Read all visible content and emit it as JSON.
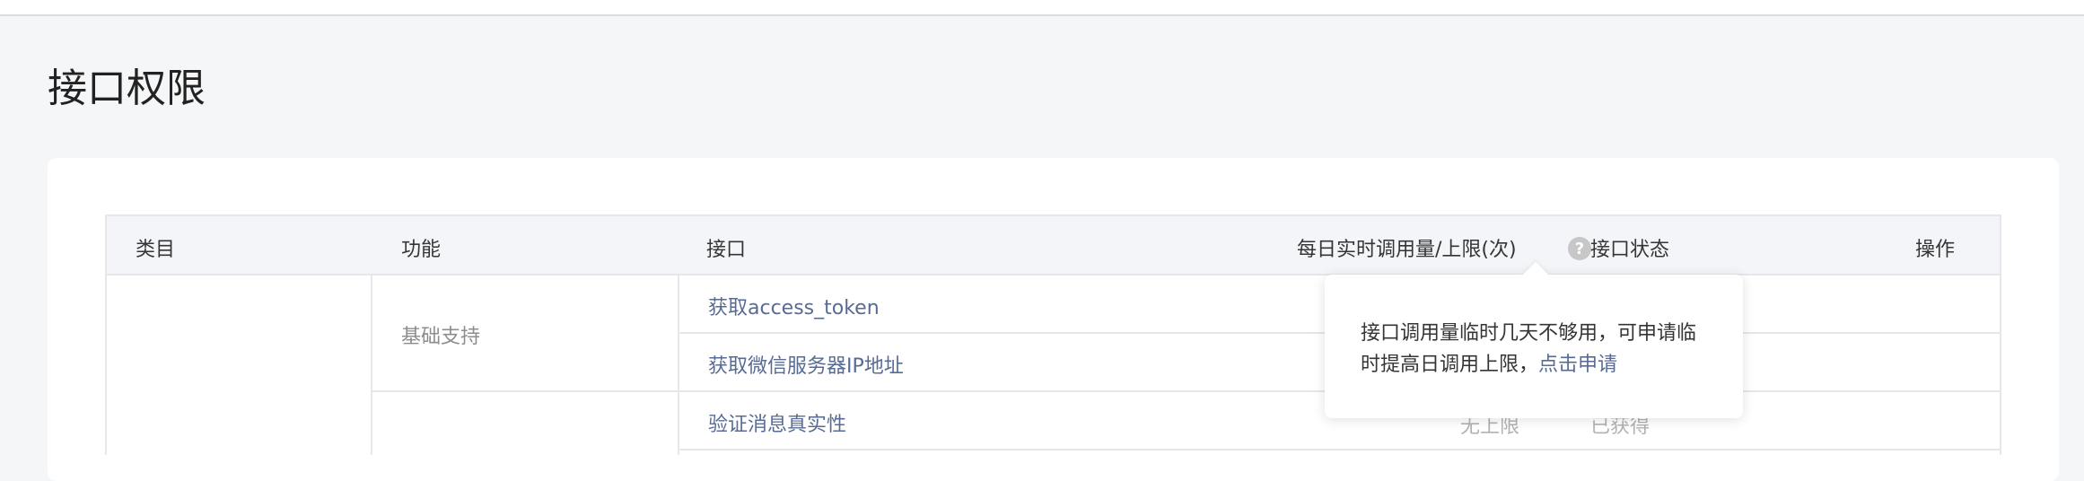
{
  "page": {
    "title": "接口权限"
  },
  "table": {
    "headers": {
      "category": "类目",
      "function": "功能",
      "api": "接口",
      "quota": "每日实时调用量/上限(次)",
      "status": "接口状态",
      "operation": "操作"
    },
    "help_icon_glyph": "?",
    "function_groups": [
      {
        "label": "基础支持"
      },
      {
        "label": ""
      }
    ],
    "rows": [
      {
        "api": "获取access_token",
        "quota": "",
        "status": ""
      },
      {
        "api": "获取微信服务器IP地址",
        "quota": "",
        "status": ""
      },
      {
        "api": "验证消息真实性",
        "quota": "无上限",
        "status": "已获得"
      }
    ]
  },
  "tooltip": {
    "line1": "接口调用量临时几天不够用，可申请临",
    "line2": "时提高日调用上限，",
    "link": "点击申请"
  },
  "colors": {
    "link": "#576b95",
    "muted": "#b2b2b2",
    "header_bg": "#f4f5f9",
    "page_bg": "#f5f6f7"
  }
}
